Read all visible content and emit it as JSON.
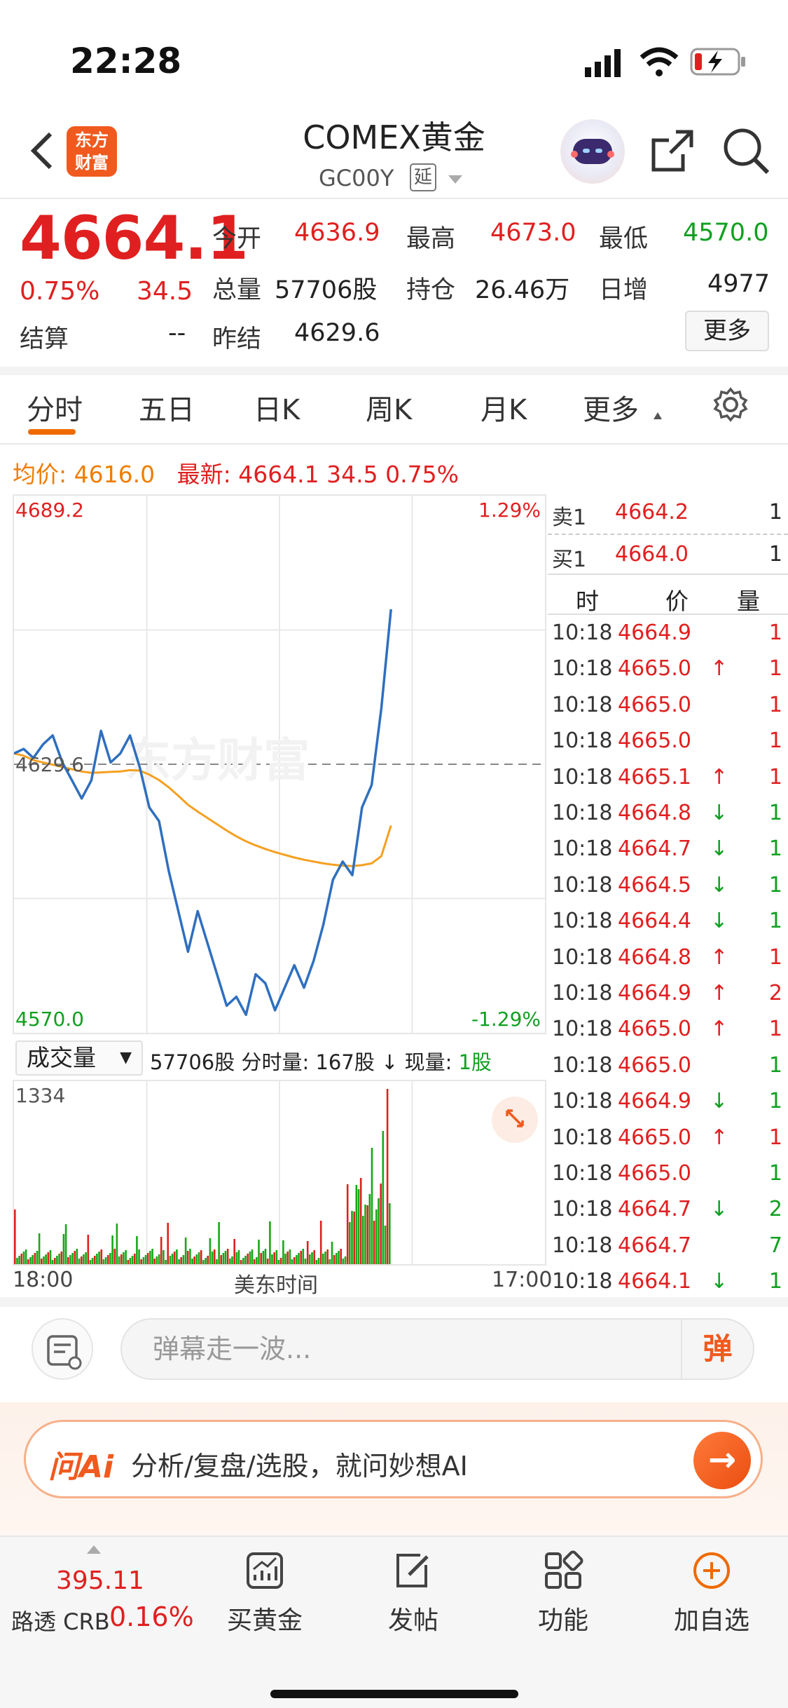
{
  "status": {
    "time": "22:28"
  },
  "nav": {
    "logo_line1": "东方",
    "logo_line2": "财富",
    "title": "COMEX黄金",
    "code": "GC00Y",
    "delay": "延"
  },
  "quote": {
    "price": "4664.1",
    "change_pct": "0.75%",
    "change": "34.5",
    "open_label": "今开",
    "open": "4636.9",
    "high_label": "最高",
    "high": "4673.0",
    "low_label": "最低",
    "low": "4570.0",
    "volume_label": "总量",
    "volume": "57706股",
    "oi_label": "持仓",
    "oi": "26.46万",
    "daily_inc_label": "日增",
    "daily_inc": "4977",
    "settle_label": "结算",
    "settle": "--",
    "prev_settle_label": "昨结",
    "prev_settle": "4629.6",
    "more": "更多"
  },
  "tabs": [
    "分时",
    "五日",
    "日K",
    "周K",
    "月K",
    "更多"
  ],
  "info_line": {
    "avg_label": "均价:",
    "avg": "4616.0",
    "latest_label": "最新:",
    "latest": "4664.1",
    "change": "34.5",
    "pct": "0.75%"
  },
  "chart_data": {
    "type": "line",
    "y_max_label": "4689.2",
    "y_min_label": "4570.0",
    "prev_close_label": "4629.6",
    "pct_max_label": "1.29%",
    "pct_min_label": "-1.29%",
    "ylim": [
      4570.0,
      4689.2
    ],
    "x_start_label": "18:00",
    "x_mid_label": "美东时间",
    "x_end_label": "17:00",
    "watermark": "东方财富",
    "series": [
      {
        "name": "最新",
        "color": "#2f6fbf",
        "values": [
          4632,
          4633,
          4631,
          4634,
          4636,
          4630,
          4626,
          4622,
          4626,
          4637,
          4630,
          4632,
          4636,
          4629,
          4620,
          4617,
          4606,
          4597,
          4588,
          4597,
          4590,
          4583,
          4576,
          4578,
          4574,
          4583,
          4581,
          4575,
          4580,
          4585,
          4580,
          4586,
          4594,
          4604,
          4608,
          4605,
          4620,
          4625,
          4642,
          4664
        ]
      },
      {
        "name": "均价",
        "color": "#f5a020",
        "values": [
          4632,
          4631.5,
          4630.5,
          4630,
          4629.5,
          4629,
          4628.5,
          4628,
          4627.7,
          4627.8,
          4627.9,
          4628,
          4628.3,
          4628.2,
          4627.3,
          4626.1,
          4624.5,
          4622.6,
          4620.6,
          4619.1,
          4617.7,
          4616.3,
          4614.9,
          4613.6,
          4612.5,
          4611.6,
          4610.8,
          4610.1,
          4609.5,
          4608.9,
          4608.4,
          4608.0,
          4607.6,
          4607.3,
          4607.1,
          4607.0,
          4607.2,
          4607.6,
          4609.2,
          4616.0
        ]
      }
    ],
    "volume": {
      "label": "成交量",
      "total": "57706股",
      "period_label": "分时量:",
      "period": "167股",
      "current_label": "现量:",
      "current": "1股",
      "ymax_label": "1334"
    }
  },
  "orderbook": {
    "ask_label": "卖1",
    "ask_price": "4664.2",
    "ask_vol": "1",
    "bid_label": "买1",
    "bid_price": "4664.0",
    "bid_vol": "1",
    "col_time": "时",
    "col_price": "价",
    "col_vol": "量",
    "trades": [
      {
        "time": "10:18",
        "price": "4664.9",
        "arrow": "",
        "vol": "1",
        "color": "red"
      },
      {
        "time": "10:18",
        "price": "4665.0",
        "arrow": "↑",
        "vol": "1",
        "color": "red"
      },
      {
        "time": "10:18",
        "price": "4665.0",
        "arrow": "",
        "vol": "1",
        "color": "red"
      },
      {
        "time": "10:18",
        "price": "4665.0",
        "arrow": "",
        "vol": "1",
        "color": "red"
      },
      {
        "time": "10:18",
        "price": "4665.1",
        "arrow": "↑",
        "vol": "1",
        "color": "red"
      },
      {
        "time": "10:18",
        "price": "4664.8",
        "arrow": "↓",
        "vol": "1",
        "color": "green"
      },
      {
        "time": "10:18",
        "price": "4664.7",
        "arrow": "↓",
        "vol": "1",
        "color": "green"
      },
      {
        "time": "10:18",
        "price": "4664.5",
        "arrow": "↓",
        "vol": "1",
        "color": "green"
      },
      {
        "time": "10:18",
        "price": "4664.4",
        "arrow": "↓",
        "vol": "1",
        "color": "green"
      },
      {
        "time": "10:18",
        "price": "4664.8",
        "arrow": "↑",
        "vol": "1",
        "color": "red"
      },
      {
        "time": "10:18",
        "price": "4664.9",
        "arrow": "↑",
        "vol": "2",
        "color": "red"
      },
      {
        "time": "10:18",
        "price": "4665.0",
        "arrow": "↑",
        "vol": "1",
        "color": "red"
      },
      {
        "time": "10:18",
        "price": "4665.0",
        "arrow": "",
        "vol": "1",
        "color": "green"
      },
      {
        "time": "10:18",
        "price": "4664.9",
        "arrow": "↓",
        "vol": "1",
        "color": "green"
      },
      {
        "time": "10:18",
        "price": "4665.0",
        "arrow": "↑",
        "vol": "1",
        "color": "red"
      },
      {
        "time": "10:18",
        "price": "4665.0",
        "arrow": "",
        "vol": "1",
        "color": "green"
      },
      {
        "time": "10:18",
        "price": "4664.7",
        "arrow": "↓",
        "vol": "2",
        "color": "green"
      },
      {
        "time": "10:18",
        "price": "4664.7",
        "arrow": "",
        "vol": "7",
        "color": "green"
      },
      {
        "time": "10:18",
        "price": "4664.1",
        "arrow": "↓",
        "vol": "1",
        "color": "green"
      }
    ]
  },
  "danmaku": {
    "placeholder": "弹幕走一波...",
    "button": "弹"
  },
  "ai": {
    "logo": "问Ai",
    "text": "分析/复盘/选股，就问妙想AI"
  },
  "bottom_bar": {
    "crb_value": "395.11",
    "crb_label": "路透 CRB",
    "crb_pct": "0.16%",
    "items": [
      "买黄金",
      "发帖",
      "功能",
      "加自选"
    ]
  },
  "colors": {
    "up": "#e02020",
    "down": "#10a020",
    "accent": "#ef6a00",
    "line": "#2f6fbf",
    "avg": "#f5a020"
  }
}
